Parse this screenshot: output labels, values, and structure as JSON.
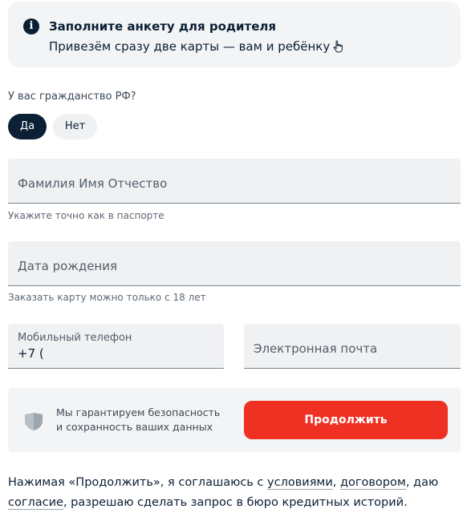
{
  "notice": {
    "title": "Заполните анкету для родителя",
    "text": "Привезём сразу две карты — вам и ребёнку",
    "info_icon": "info-icon",
    "hand_icon": "pointing-hand-icon"
  },
  "citizenship": {
    "question": "У вас гражданство РФ?",
    "yes_label": "Да",
    "no_label": "Нет",
    "selected": "Да"
  },
  "form": {
    "full_name": {
      "placeholder": "Фамилия Имя Отчество",
      "hint": "Укажите точно как в паспорте"
    },
    "birth_date": {
      "placeholder": "Дата рождения",
      "hint": "Заказать карту можно только с 18 лет"
    },
    "phone": {
      "label": "Мобильный телефон",
      "value": "+7 ("
    },
    "email": {
      "placeholder": "Электронная почта"
    }
  },
  "security": {
    "icon": "shield-icon",
    "text_line1": "Мы гарантируем безопасность",
    "text_line2": "и сохранность ваших данных",
    "continue_label": "Продолжить"
  },
  "consent": {
    "part1": "Нажимая «Продолжить», я соглашаюсь с ",
    "link_terms": "условиями",
    "sep1": ", ",
    "link_contract": "договором",
    "part2": ", даю ",
    "link_consent": "согласие",
    "part3": ", разрешаю сделать запрос в бюро кредитных историй."
  },
  "colors": {
    "accent": "#ef3124",
    "text_primary": "#0b1f35",
    "field_bg": "#f0f1f2",
    "panel_bg": "#f3f4f5"
  }
}
